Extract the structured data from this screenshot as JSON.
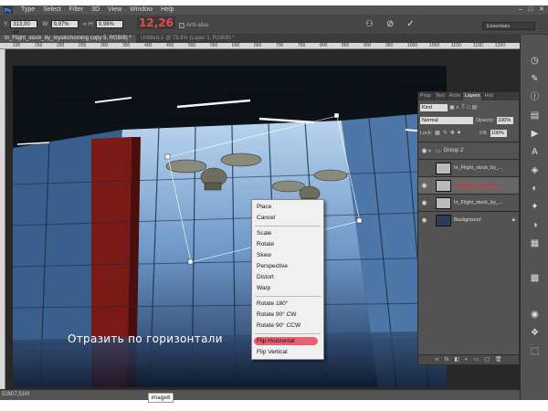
{
  "menubar": {
    "items": [
      "Type",
      "Select",
      "Filter",
      "3D",
      "View",
      "Window",
      "Help"
    ],
    "win_controls": [
      "–",
      "□",
      "✕"
    ]
  },
  "options": {
    "x_label": "Y:",
    "x_value": "313,00 px",
    "w_label": "W:",
    "w_value": "9,97%",
    "h_label": "H:",
    "h_value": "9,98%",
    "angle_value": "12,26",
    "antialias_label": "Anti-alias",
    "workspace": "Essentials"
  },
  "tabs": [
    {
      "label": "In_Flight_stock_by_mysticmorning copy 5, RGB/8) *",
      "active": true
    },
    {
      "label": "Untitled-1 @ 73,9% (Layer 1, RGB/8) *",
      "active": false
    }
  ],
  "ruler_ticks": [
    "100",
    "150",
    "200",
    "250",
    "300",
    "350",
    "400",
    "450",
    "500",
    "550",
    "600",
    "650",
    "700",
    "750",
    "800",
    "850",
    "900",
    "950",
    "1000",
    "1050",
    "1100",
    "1150",
    "1200"
  ],
  "layers_panel": {
    "tabs": [
      "Prop",
      "Tool",
      "Actio",
      "Layers",
      "Hist"
    ],
    "active_tab": "Layers",
    "kind": "Kind",
    "blend_mode": "Normal",
    "opacity_label": "Opacity:",
    "opacity_value": "100%",
    "lock_label": "Lock:",
    "fill_label": "Fill:",
    "fill_value": "100%",
    "layers": [
      {
        "name": "Group 2",
        "type": "group"
      },
      {
        "name": "In_Flight_stock_by_...",
        "type": "layer"
      },
      {
        "name": "In_Flight_stock_by_...",
        "type": "layer",
        "selected": true
      },
      {
        "name": "In_Flight_stock_by_...",
        "type": "layer"
      },
      {
        "name": "Background",
        "type": "background"
      }
    ]
  },
  "context_menu": {
    "group1": [
      "Place",
      "Cancel"
    ],
    "group2": [
      "Scale",
      "Rotate",
      "Skew",
      "Perspective",
      "Distort",
      "Warp"
    ],
    "group3": [
      "Rotate 180°",
      "Rotate 90° CW",
      "Rotate 90° CCW"
    ],
    "group4": [
      "Flip Horizontal",
      "Flip Vertical"
    ],
    "highlight_color": "#e6465a"
  },
  "annotation": "Отразить по горизонтали",
  "status": {
    "doc_size": "52M/7,51M",
    "image_label": "image8"
  }
}
